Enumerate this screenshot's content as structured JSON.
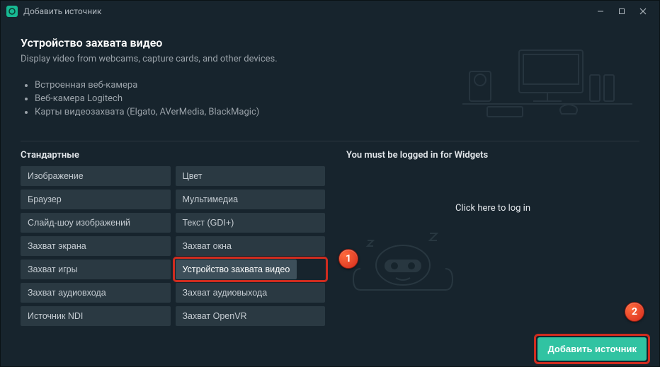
{
  "titlebar": {
    "title": "Добавить источник"
  },
  "header": {
    "title": "Устройство захвата видео",
    "subtitle": "Display video from webcams, capture cards, and other devices."
  },
  "examples": [
    "Встроенная веб-камера",
    "Веб-камера Logitech",
    "Карты видеозахвата (Elgato, AVerMedia, BlackMagic)"
  ],
  "standard": {
    "title": "Стандартные",
    "items": [
      "Изображение",
      "Цвет",
      "Браузер",
      "Мультимедиа",
      "Слайд-шоу изображений",
      "Текст (GDI+)",
      "Захват экрана",
      "Захват окна",
      "Захват игры",
      "Устройство захвата видео",
      "Захват аудиовхода",
      "Захват аудиовыхода",
      "Источник NDI",
      "Захват OpenVR"
    ],
    "selected_index": 9
  },
  "widgets": {
    "title": "You must be logged in for Widgets",
    "login_text": "Click here to log in"
  },
  "footer": {
    "add_label": "Добавить источник"
  },
  "badges": {
    "b1": "1",
    "b2": "2"
  }
}
